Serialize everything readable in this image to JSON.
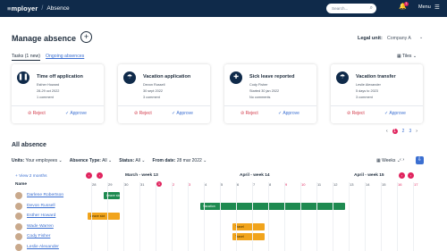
{
  "topbar": {
    "logo": "≡mployer",
    "title": "Absence",
    "search_placeholder": "Search...",
    "notification_count": "1",
    "menu_label": "Menu"
  },
  "page": {
    "title": "Manage absence",
    "legal_unit_label": "Legal unit:",
    "legal_unit_value": "Company A"
  },
  "tabs": {
    "tasks": "Tasks (1 new)",
    "ongoing": "Ongoing absences",
    "view": "Tiles"
  },
  "tasks": [
    {
      "title": "Time off application",
      "person": "Esther Howard",
      "date": "28-29 oct 2022",
      "comments": "1 comment",
      "icon": "pause-icon"
    },
    {
      "title": "Vacation application",
      "person": "Devon Russell",
      "date": "30 sept 2022",
      "comments": "3 comment",
      "icon": "umbrella-icon"
    },
    {
      "title": "Sick leave reported",
      "person": "Cody Fisher",
      "date": "Started 30 jan 2022",
      "comments": "No comments",
      "icon": "plus-icon"
    },
    {
      "title": "Vacation transfer",
      "person": "Leslie Alexander",
      "date": "5 days to 2023",
      "comments": "3 comment",
      "icon": "umbrella-icon"
    }
  ],
  "actions": {
    "reject": "Reject",
    "approve": "Approve"
  },
  "pager": {
    "current": "1",
    "pages": [
      "2",
      "3"
    ]
  },
  "all_absence": {
    "title": "All absence",
    "filters": [
      {
        "label": "Units:",
        "value": "Your employees"
      },
      {
        "label": "Absence Type:",
        "value": "All"
      },
      {
        "label": "Status:",
        "value": "All"
      },
      {
        "label": "From date:",
        "value": "28 mar 2022"
      }
    ],
    "weeks_label": "Weeks",
    "view_months": "View 2 months",
    "name_header": "Name",
    "week_labels": [
      "March - week 13",
      "April - week 14",
      "April - week 15"
    ],
    "days": [
      "28",
      "29",
      "30",
      "31",
      "1",
      "2",
      "3",
      "4",
      "5",
      "6",
      "7",
      "8",
      "9",
      "10",
      "11",
      "12",
      "13",
      "14",
      "15",
      "16",
      "17"
    ]
  },
  "employees": [
    {
      "name": "Darlene Robertson",
      "bar": "Leave slot",
      "color": "green"
    },
    {
      "name": "Devon Russell",
      "bar": "Vacation",
      "color": "green"
    },
    {
      "name": "Esther Howard",
      "bar": "Leave slot",
      "color": "orange"
    },
    {
      "name": "Wade Warren",
      "bar": "Travel",
      "color": "orange"
    },
    {
      "name": "Cody Fisher",
      "bar": "Travel",
      "color": "orange"
    },
    {
      "name": "Leslie Alexander",
      "bar": "",
      "color": ""
    }
  ]
}
